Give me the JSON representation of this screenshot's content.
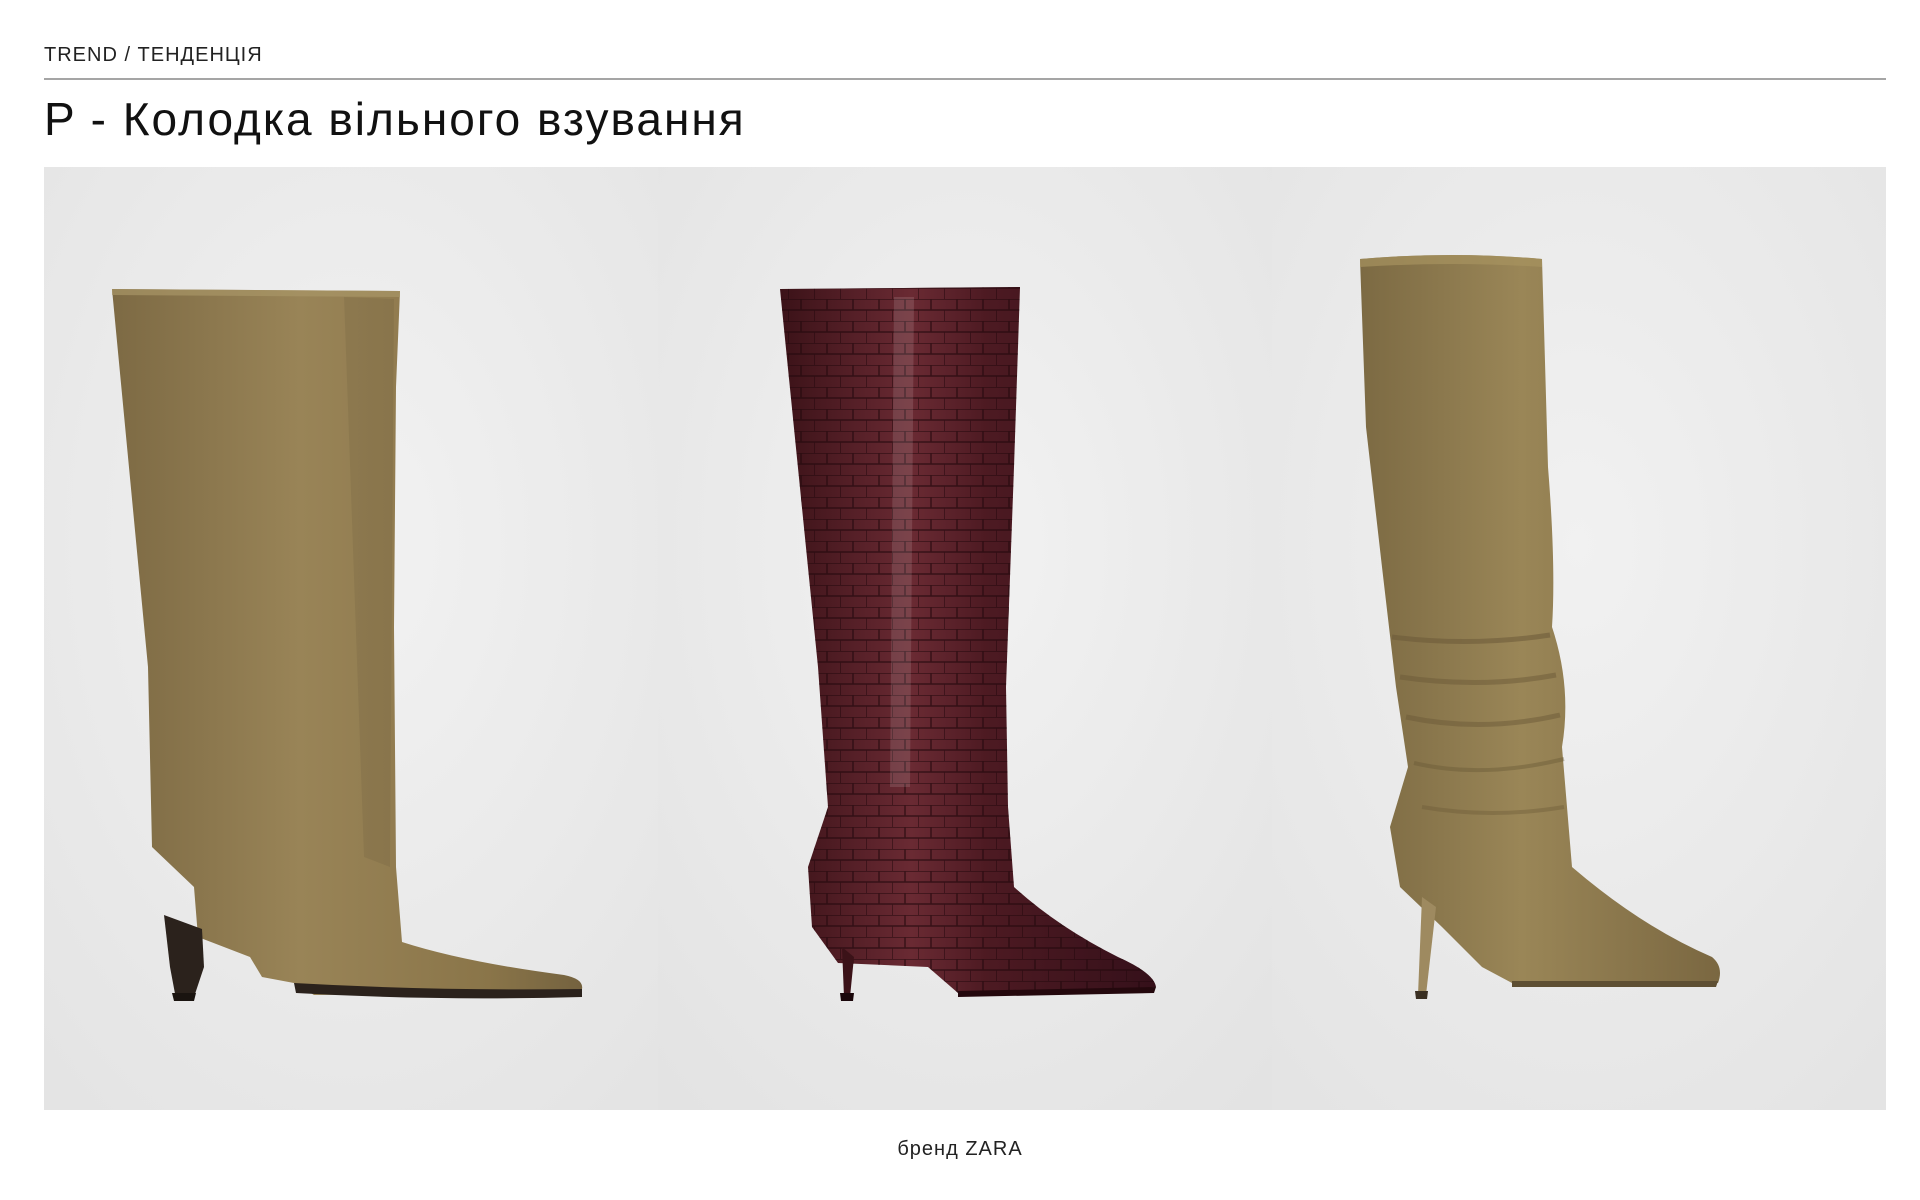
{
  "header": {
    "section_label": "TREND / ТЕНДЕНЦІЯ",
    "title": "P - Колодка вільного взування"
  },
  "gallery": {
    "items": [
      {
        "name": "olive-suede-straight-boot",
        "color": "#8f7a52",
        "heel_color": "#2b221c"
      },
      {
        "name": "burgundy-croc-boot",
        "color": "#4f1d24",
        "heel_color": "#4f1d24"
      },
      {
        "name": "olive-suede-slouch-boot",
        "color": "#8c7a52",
        "heel_color": "#9e8a60"
      }
    ],
    "background_color": "#ebebeb"
  },
  "footer": {
    "caption": "бренд ZARA"
  }
}
